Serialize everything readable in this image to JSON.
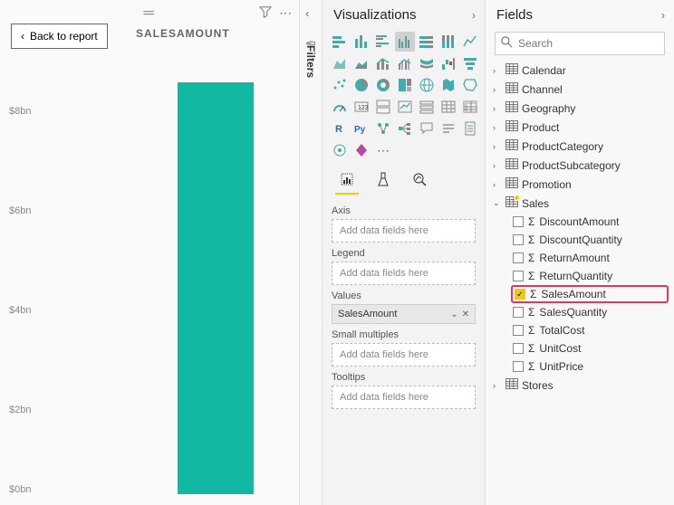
{
  "report": {
    "back_label": "Back to report",
    "title": "SALESAMOUNT",
    "y_labels": {
      "y8": "$8bn",
      "y6": "$6bn",
      "y4": "$4bn",
      "y2": "$2bn",
      "y0": "$0bn"
    }
  },
  "filters_pane": {
    "label": "Filters"
  },
  "viz_pane": {
    "title": "Visualizations",
    "wells": {
      "axis_label": "Axis",
      "axis_placeholder": "Add data fields here",
      "legend_label": "Legend",
      "legend_placeholder": "Add data fields here",
      "values_label": "Values",
      "values_item": "SalesAmount",
      "small_multiples_label": "Small multiples",
      "small_multiples_placeholder": "Add data fields here",
      "tooltips_label": "Tooltips",
      "tooltips_placeholder": "Add data fields here"
    }
  },
  "fields_pane": {
    "title": "Fields",
    "search_placeholder": "Search",
    "tables": [
      {
        "name": "Calendar",
        "expanded": false
      },
      {
        "name": "Channel",
        "expanded": false
      },
      {
        "name": "Geography",
        "expanded": false
      },
      {
        "name": "Product",
        "expanded": false
      },
      {
        "name": "ProductCategory",
        "expanded": false
      },
      {
        "name": "ProductSubcategory",
        "expanded": false
      },
      {
        "name": "Promotion",
        "expanded": false
      },
      {
        "name": "Sales",
        "expanded": true,
        "fields": [
          {
            "name": "DiscountAmount",
            "checked": false
          },
          {
            "name": "DiscountQuantity",
            "checked": false
          },
          {
            "name": "ReturnAmount",
            "checked": false
          },
          {
            "name": "ReturnQuantity",
            "checked": false
          },
          {
            "name": "SalesAmount",
            "checked": true,
            "highlight": true
          },
          {
            "name": "SalesQuantity",
            "checked": false
          },
          {
            "name": "TotalCost",
            "checked": false
          },
          {
            "name": "UnitCost",
            "checked": false
          },
          {
            "name": "UnitPrice",
            "checked": false
          }
        ]
      },
      {
        "name": "Stores",
        "expanded": false
      }
    ]
  },
  "chart_data": {
    "type": "bar",
    "categories": [
      "SalesAmount"
    ],
    "values": [
      8.3
    ],
    "title": "SALESAMOUNT",
    "xlabel": "",
    "ylabel": "",
    "ylim": [
      0,
      9
    ],
    "y_unit": "$bn",
    "y_ticks": [
      0,
      2,
      4,
      6,
      8
    ]
  }
}
